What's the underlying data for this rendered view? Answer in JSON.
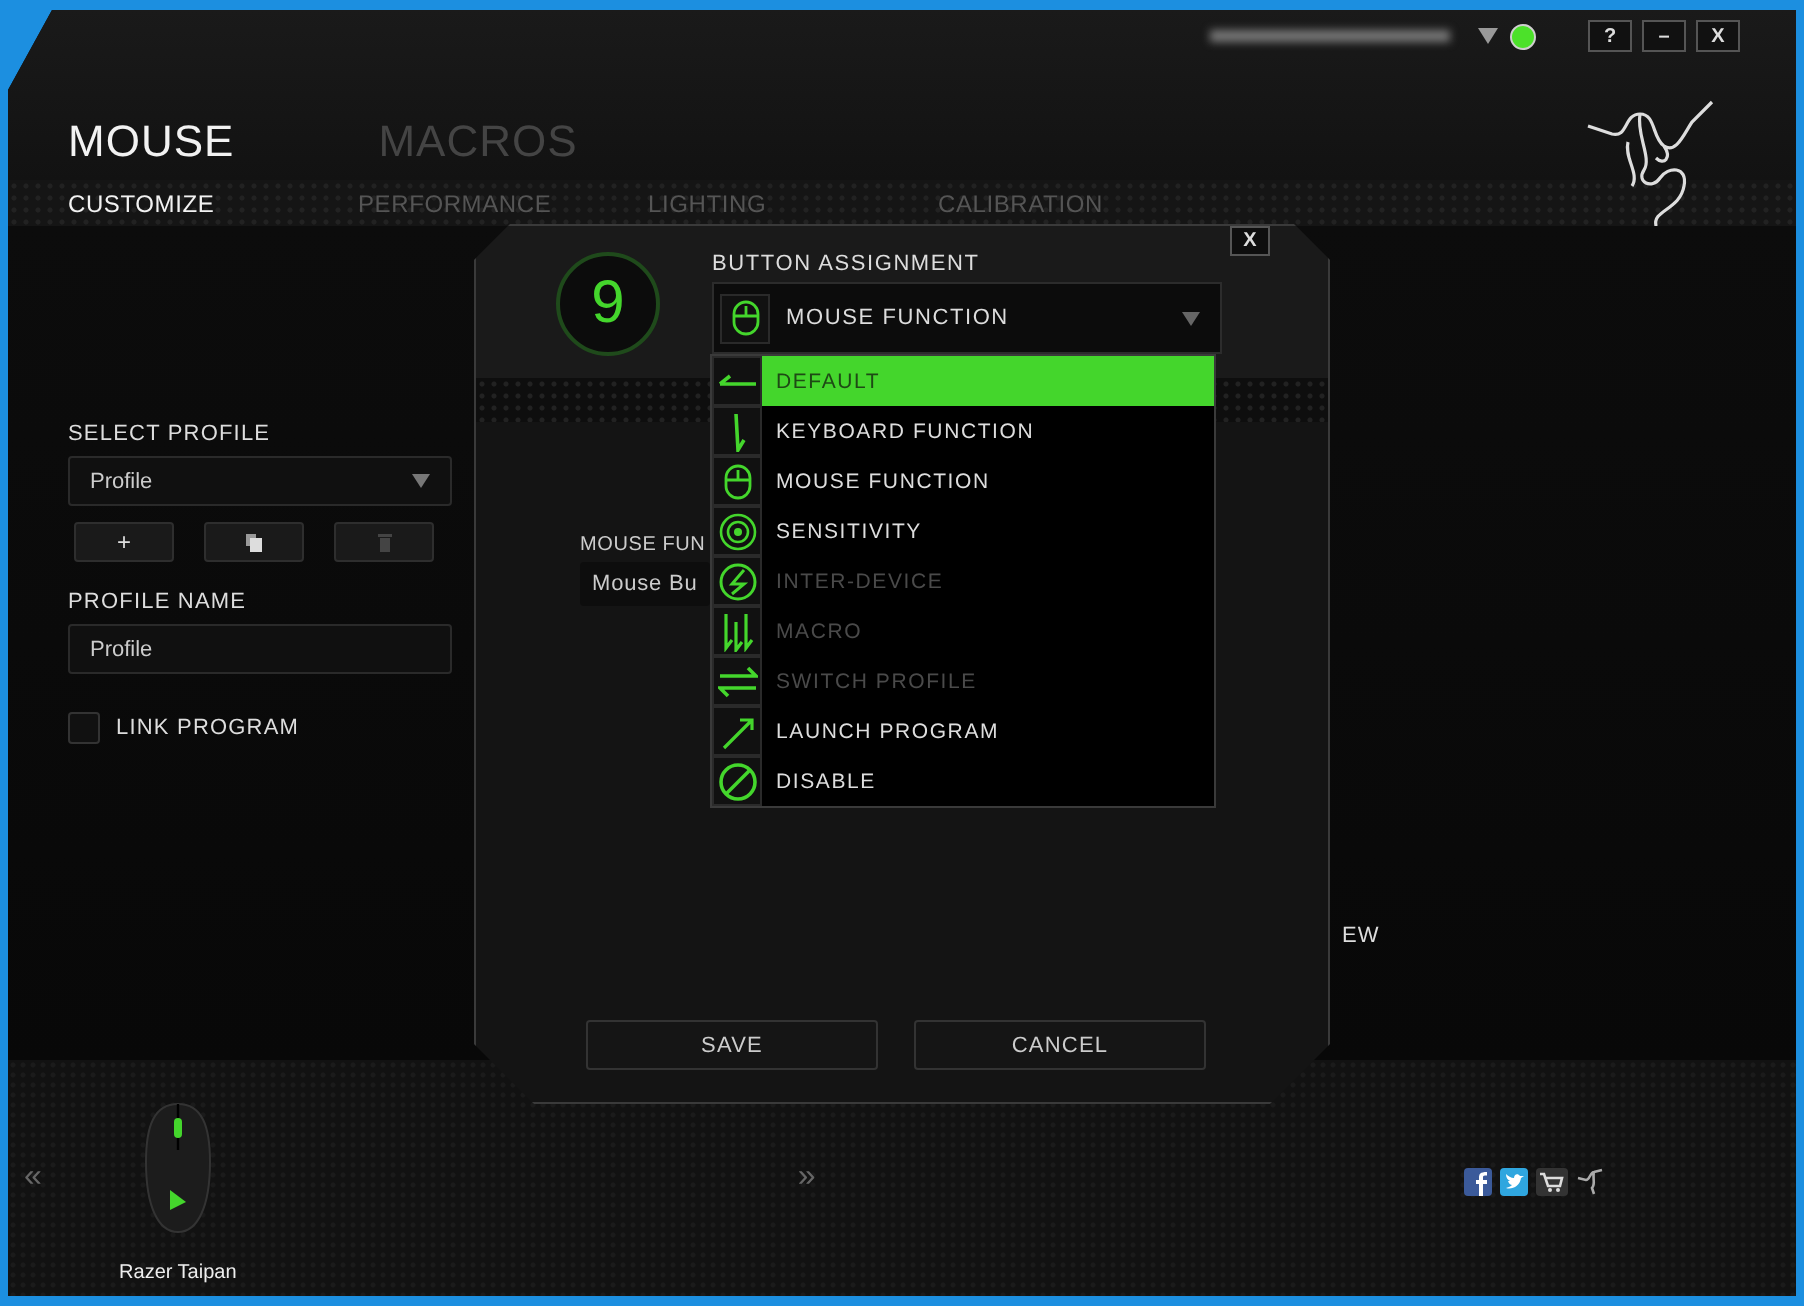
{
  "window_controls": [
    "?",
    "–",
    "X"
  ],
  "account": {
    "online": true
  },
  "main_tabs": [
    {
      "label": "MOUSE",
      "selected": true
    },
    {
      "label": "MACROS",
      "selected": false
    }
  ],
  "sub_tabs": [
    {
      "label": "CUSTOMIZE",
      "selected": true
    },
    {
      "label": "PERFORMANCE",
      "selected": false
    },
    {
      "label": "LIGHTING",
      "selected": false
    },
    {
      "label": "CALIBRATION",
      "selected": false
    }
  ],
  "profile": {
    "select_label": "SELECT PROFILE",
    "selected_profile": "Profile",
    "name_label": "PROFILE NAME",
    "name_value": "Profile"
  },
  "profile_buttons": [
    {
      "kind": "add",
      "label": "+",
      "disabled": false
    },
    {
      "kind": "copy",
      "disabled": false
    },
    {
      "kind": "delete",
      "disabled": true
    }
  ],
  "link_program": {
    "label": "LINK PROGRAM",
    "checked": false
  },
  "behind_text": "EW",
  "dialog": {
    "button_number": "9",
    "close": "X",
    "title": "BUTTON ASSIGNMENT",
    "dropdown_value": "MOUSE FUNCTION",
    "expanded": true,
    "field_label": "MOUSE FUN",
    "field_value": "Mouse Bu",
    "options": [
      {
        "kind": "default",
        "label": "DEFAULT",
        "selected": true,
        "disabled": false
      },
      {
        "kind": "keyboard",
        "label": "KEYBOARD FUNCTION",
        "selected": false,
        "disabled": false
      },
      {
        "kind": "mouse",
        "label": "MOUSE FUNCTION",
        "selected": false,
        "disabled": false
      },
      {
        "kind": "sensitivity",
        "label": "SENSITIVITY",
        "selected": false,
        "disabled": false
      },
      {
        "kind": "interdevice",
        "label": "INTER-DEVICE",
        "selected": false,
        "disabled": true
      },
      {
        "kind": "macro",
        "label": "MACRO",
        "selected": false,
        "disabled": true
      },
      {
        "kind": "switch",
        "label": "SWITCH PROFILE",
        "selected": false,
        "disabled": true
      },
      {
        "kind": "launch",
        "label": "LAUNCH PROGRAM",
        "selected": false,
        "disabled": false
      },
      {
        "kind": "disable",
        "label": "DISABLE",
        "selected": false,
        "disabled": false
      }
    ],
    "buttons": [
      "SAVE",
      "CANCEL"
    ]
  },
  "device": {
    "prev": "«",
    "name": "Razer Taipan",
    "next": "»"
  }
}
